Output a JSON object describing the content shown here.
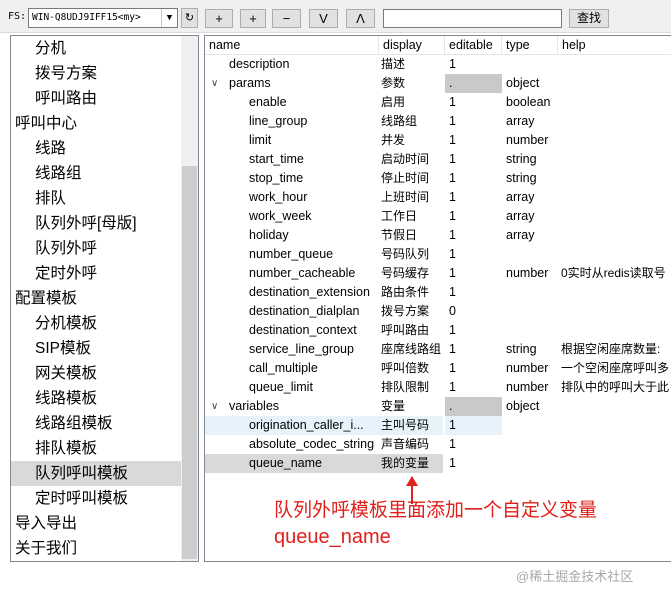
{
  "toolbar": {
    "fs_label": "FS:",
    "fs_value": "WIN-Q8UDJ9IFF15<my>",
    "buttons": [
      "+",
      "+",
      "−",
      "V",
      "Λ"
    ],
    "search_placeholder": "",
    "find_label": "查找"
  },
  "nav": {
    "items": [
      {
        "label": "分机",
        "level": 1
      },
      {
        "label": "拨号方案",
        "level": 1
      },
      {
        "label": "呼叫路由",
        "level": 1
      },
      {
        "label": "呼叫中心",
        "level": 0
      },
      {
        "label": "线路",
        "level": 1
      },
      {
        "label": "线路组",
        "level": 1
      },
      {
        "label": "排队",
        "level": 1
      },
      {
        "label": "队列外呼[母版]",
        "level": 1
      },
      {
        "label": "队列外呼",
        "level": 1
      },
      {
        "label": "定时外呼",
        "level": 1
      },
      {
        "label": "配置模板",
        "level": 0
      },
      {
        "label": "分机模板",
        "level": 1
      },
      {
        "label": "SIP模板",
        "level": 1
      },
      {
        "label": "网关模板",
        "level": 1
      },
      {
        "label": "线路模板",
        "level": 1
      },
      {
        "label": "线路组模板",
        "level": 1
      },
      {
        "label": "排队模板",
        "level": 1
      },
      {
        "label": "队列呼叫模板",
        "level": 1,
        "selected": true
      },
      {
        "label": "定时呼叫模板",
        "level": 1
      },
      {
        "label": "导入导出",
        "level": 0
      },
      {
        "label": "关于我们",
        "level": 0
      }
    ]
  },
  "grid": {
    "columns": [
      "name",
      "display",
      "editable",
      "type",
      "help"
    ],
    "rows": [
      {
        "indent": 1,
        "name": "description",
        "display": "描述",
        "editable": "1",
        "type": "",
        "help": ""
      },
      {
        "indent": 0,
        "expander": "∨",
        "name": "params",
        "display": "参数",
        "editable": ".",
        "editable_grey": true,
        "type": "object",
        "help": ""
      },
      {
        "indent": 2,
        "name": "enable",
        "display": "启用",
        "editable": "1",
        "type": "boolean",
        "help": ""
      },
      {
        "indent": 2,
        "name": "line_group",
        "display": "线路组",
        "editable": "1",
        "type": "array",
        "help": ""
      },
      {
        "indent": 2,
        "name": "limit",
        "display": "并发",
        "editable": "1",
        "type": "number",
        "help": ""
      },
      {
        "indent": 2,
        "name": "start_time",
        "display": "启动时间",
        "editable": "1",
        "type": "string",
        "help": ""
      },
      {
        "indent": 2,
        "name": "stop_time",
        "display": "停止时间",
        "editable": "1",
        "type": "string",
        "help": ""
      },
      {
        "indent": 2,
        "name": "work_hour",
        "display": "上班时间",
        "editable": "1",
        "type": "array",
        "help": ""
      },
      {
        "indent": 2,
        "name": "work_week",
        "display": "工作日",
        "editable": "1",
        "type": "array",
        "help": ""
      },
      {
        "indent": 2,
        "name": "holiday",
        "display": "节假日",
        "editable": "1",
        "type": "array",
        "help": ""
      },
      {
        "indent": 2,
        "name": "number_queue",
        "display": "号码队列",
        "editable": "1",
        "type": "",
        "help": ""
      },
      {
        "indent": 2,
        "name": "number_cacheable",
        "display": "号码缓存",
        "editable": "1",
        "type": "number",
        "help": "0实时从redis读取号"
      },
      {
        "indent": 2,
        "name": "destination_extension",
        "display": "路由条件",
        "editable": "1",
        "type": "",
        "help": ""
      },
      {
        "indent": 2,
        "name": "destination_dialplan",
        "display": "拨号方案",
        "editable": "0",
        "type": "",
        "help": ""
      },
      {
        "indent": 2,
        "name": "destination_context",
        "display": "呼叫路由",
        "editable": "1",
        "type": "",
        "help": ""
      },
      {
        "indent": 2,
        "name": "service_line_group",
        "display": "座席线路组",
        "editable": "1",
        "type": "string",
        "help": "根据空闲座席数量:"
      },
      {
        "indent": 2,
        "name": "call_multiple",
        "display": "呼叫倍数",
        "editable": "1",
        "type": "number",
        "help": "一个空闲座席呼叫多"
      },
      {
        "indent": 2,
        "name": "queue_limit",
        "display": "排队限制",
        "editable": "1",
        "type": "number",
        "help": "排队中的呼叫大于此"
      },
      {
        "indent": 0,
        "expander": "∨",
        "name": "variables",
        "display": "变量",
        "editable": ".",
        "editable_grey": true,
        "type": "object",
        "help": ""
      },
      {
        "indent": 2,
        "name": "origination_caller_i...",
        "display": "主叫号码",
        "editable": "1",
        "type": "",
        "help": "",
        "edited": true
      },
      {
        "indent": 2,
        "name": "absolute_codec_string",
        "display": "声音编码",
        "editable": "1",
        "type": "",
        "help": ""
      },
      {
        "indent": 2,
        "name": "queue_name",
        "display": "我的变量",
        "editable": "1",
        "type": "",
        "help": "",
        "selected": true
      }
    ]
  },
  "annotation": {
    "line1": "队列外呼模板里面添加一个自定义变量",
    "line2": "queue_name",
    "color": "#e0201b"
  },
  "watermark": "@稀土掘金技术社区"
}
